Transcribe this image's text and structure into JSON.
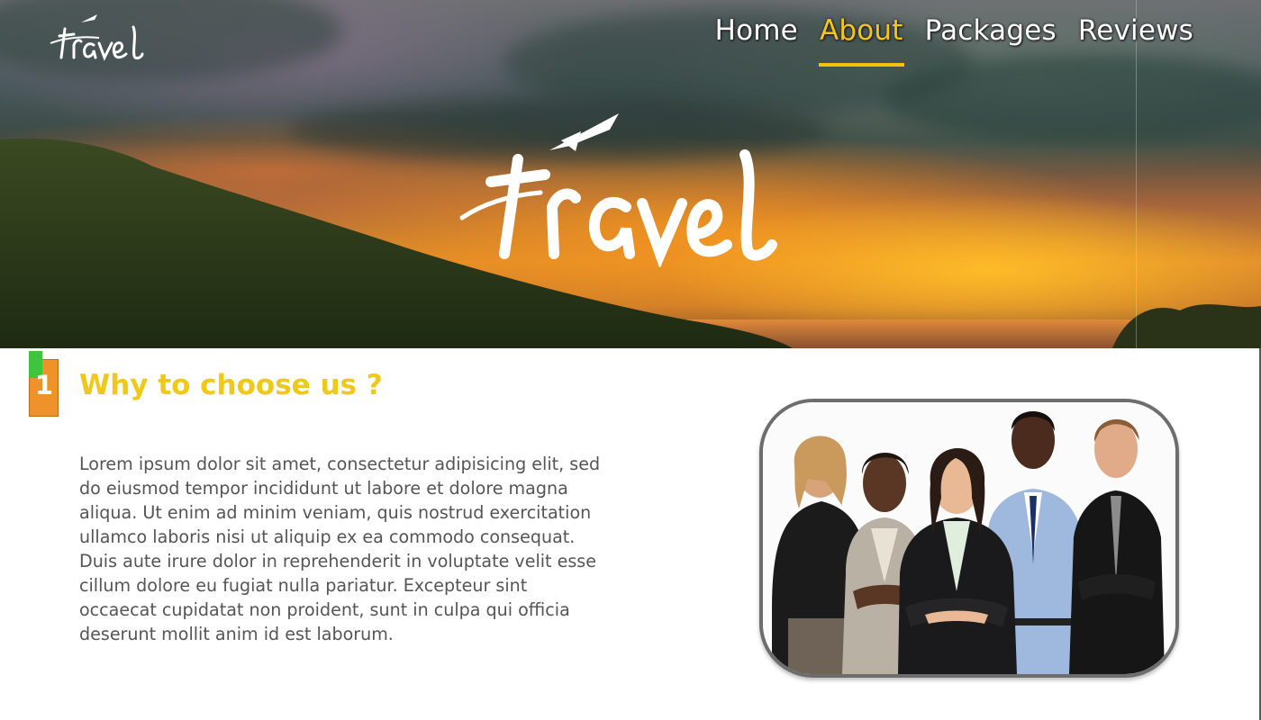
{
  "header": {
    "logo_text": "travel",
    "nav": [
      {
        "label": "Home",
        "active": false
      },
      {
        "label": "About",
        "active": true
      },
      {
        "label": "Packages",
        "active": false
      },
      {
        "label": "Reviews",
        "active": false
      }
    ]
  },
  "hero": {
    "logo_text": "travel"
  },
  "section": {
    "number": "1",
    "title": "Why to choose us ?",
    "body": "Lorem ipsum dolor sit amet, consectetur adipisicing elit, sed do eiusmod tempor incididunt ut labore et dolore magna aliqua. Ut enim ad minim veniam, quis nostrud exercitation ullamco laboris nisi ut aliquip ex ea commodo consequat. Duis aute irure dolor in reprehenderit in voluptate velit esse cillum dolore eu fugiat nulla pariatur. Excepteur sint occaecat cupidatat non proident, sunt in culpa qui officia deserunt mollit anim id est laborum."
  },
  "colors": {
    "accent": "#f2c20c",
    "badge_orange": "#f0922a",
    "badge_green": "#3ec43e",
    "body_text": "#555555"
  },
  "icons": {
    "nav_logo": "travel-logo-icon",
    "hero_logo": "travel-airplane-logo-icon",
    "team_photo": "business-team-photo"
  }
}
